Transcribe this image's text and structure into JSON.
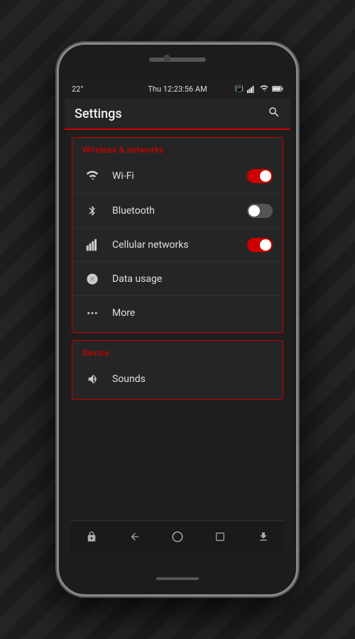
{
  "status": {
    "temperature": "22°",
    "time": "Thu 12:23:56 AM",
    "icons": [
      "vibrate",
      "signal",
      "wifi",
      "battery"
    ]
  },
  "appBar": {
    "title": "Settings",
    "searchLabel": "search"
  },
  "sections": [
    {
      "id": "wireless",
      "header": "Wireless & networks",
      "items": [
        {
          "id": "wifi",
          "label": "Wi-Fi",
          "icon": "wifi",
          "toggle": true,
          "toggleState": "on"
        },
        {
          "id": "bluetooth",
          "label": "Bluetooth",
          "icon": "bluetooth",
          "toggle": true,
          "toggleState": "off"
        },
        {
          "id": "cellular",
          "label": "Cellular networks",
          "icon": "cellular",
          "toggle": true,
          "toggleState": "on"
        },
        {
          "id": "data-usage",
          "label": "Data usage",
          "icon": "data-usage",
          "toggle": false
        },
        {
          "id": "more",
          "label": "More",
          "icon": "more",
          "toggle": false
        }
      ]
    },
    {
      "id": "device",
      "header": "Device",
      "items": [
        {
          "id": "sounds",
          "label": "Sounds",
          "icon": "volume",
          "toggle": false
        }
      ]
    }
  ],
  "navBar": {
    "items": [
      "lock",
      "back",
      "home",
      "recent",
      "download"
    ]
  }
}
